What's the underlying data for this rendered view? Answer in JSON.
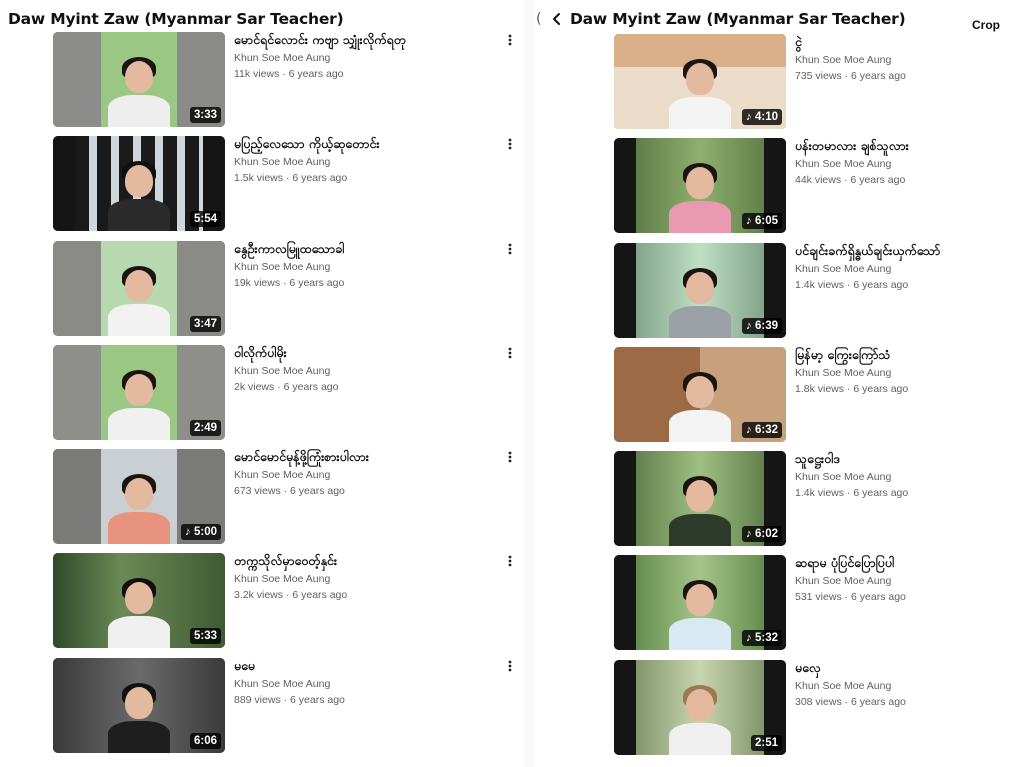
{
  "left": {
    "title": "Daw Myint Zaw (Myanmar Sar Teacher)",
    "videos": [
      {
        "title": "မောင်ရင်လောင်း ကဗျာ သျှုံးလိုက်ရတု",
        "channel": "Khun Soe Moe Aung",
        "stats": "11k views · 6 years ago",
        "duration": "3:33"
      },
      {
        "title": "မပြည့်လေသော ကိုယ့်ဆုတောင်း",
        "channel": "Khun Soe Moe Aung",
        "stats": "1.5k views · 6 years ago",
        "duration": "5:54"
      },
      {
        "title": "နွေဦးကာလမြူထသောခါ",
        "channel": "Khun Soe Moe Aung",
        "stats": "19k views · 6 years ago",
        "duration": "3:47"
      },
      {
        "title": "ဝါလိုက်ပါမိုး",
        "channel": "Khun Soe Moe Aung",
        "stats": "2k views · 6 years ago",
        "duration": "2:49"
      },
      {
        "title": "မောင်မောင်မုန့်ဖို့ကြုံးစားပါလား",
        "channel": "Khun Soe Moe Aung",
        "stats": "673 views · 6 years ago",
        "duration": "♪ 5:00"
      },
      {
        "title": "တက္ကသိုလ်မှာဝေတ့်နှင်း",
        "channel": "Khun Soe Moe Aung",
        "stats": "3.2k views · 6 years ago",
        "duration": "5:33"
      },
      {
        "title": "မမေ",
        "channel": "Khun Soe Moe Aung",
        "stats": "889 views · 6 years ago",
        "duration": "6:06"
      }
    ]
  },
  "right": {
    "title": "Daw Myint Zaw (Myanmar Sar Teacher)",
    "partial_char": "(",
    "crop_label": "Crop",
    "videos": [
      {
        "title": "ငွဲ",
        "channel": "Khun Soe Moe Aung",
        "stats": "735 views · 6 years ago",
        "duration": "♪ 4:10"
      },
      {
        "title": "ပန်းတမာလား ချစ်သူလား",
        "channel": "Khun Soe Moe Aung",
        "stats": "44k views · 6 years ago",
        "duration": "♪ 6:05"
      },
      {
        "title": "ပင်ချင်းခက်ရှိန္ဓယ်ချင်းယှက်သော်",
        "channel": "Khun Soe Moe Aung",
        "stats": "1.4k views · 6 years ago",
        "duration": "♪ 6:39"
      },
      {
        "title": "မြန်မာ့ ကြွေးကြော်သံ",
        "channel": "Khun Soe Moe Aung",
        "stats": "1.8k views · 6 years ago",
        "duration": "♪ 6:32"
      },
      {
        "title": "သူဋ္ဌေးဝါဒ",
        "channel": "Khun Soe Moe Aung",
        "stats": "1.4k views · 6 years ago",
        "duration": "♪ 6:02"
      },
      {
        "title": "ဆရာမ ပုံပြင်ပြောပြပါ",
        "channel": "Khun Soe Moe Aung",
        "stats": "531 views · 6 years ago",
        "duration": "♪ 5:32"
      },
      {
        "title": "မလှေ",
        "channel": "Khun Soe Moe Aung",
        "stats": "308 views · 6 years ago",
        "duration": "2:51"
      }
    ]
  },
  "icons": {
    "back": "chevron-left-icon",
    "more": "more-vertical-icon"
  },
  "colors": {
    "text": "#0f0f0f",
    "secondary": "#606060",
    "duration_bg": "#000000"
  }
}
